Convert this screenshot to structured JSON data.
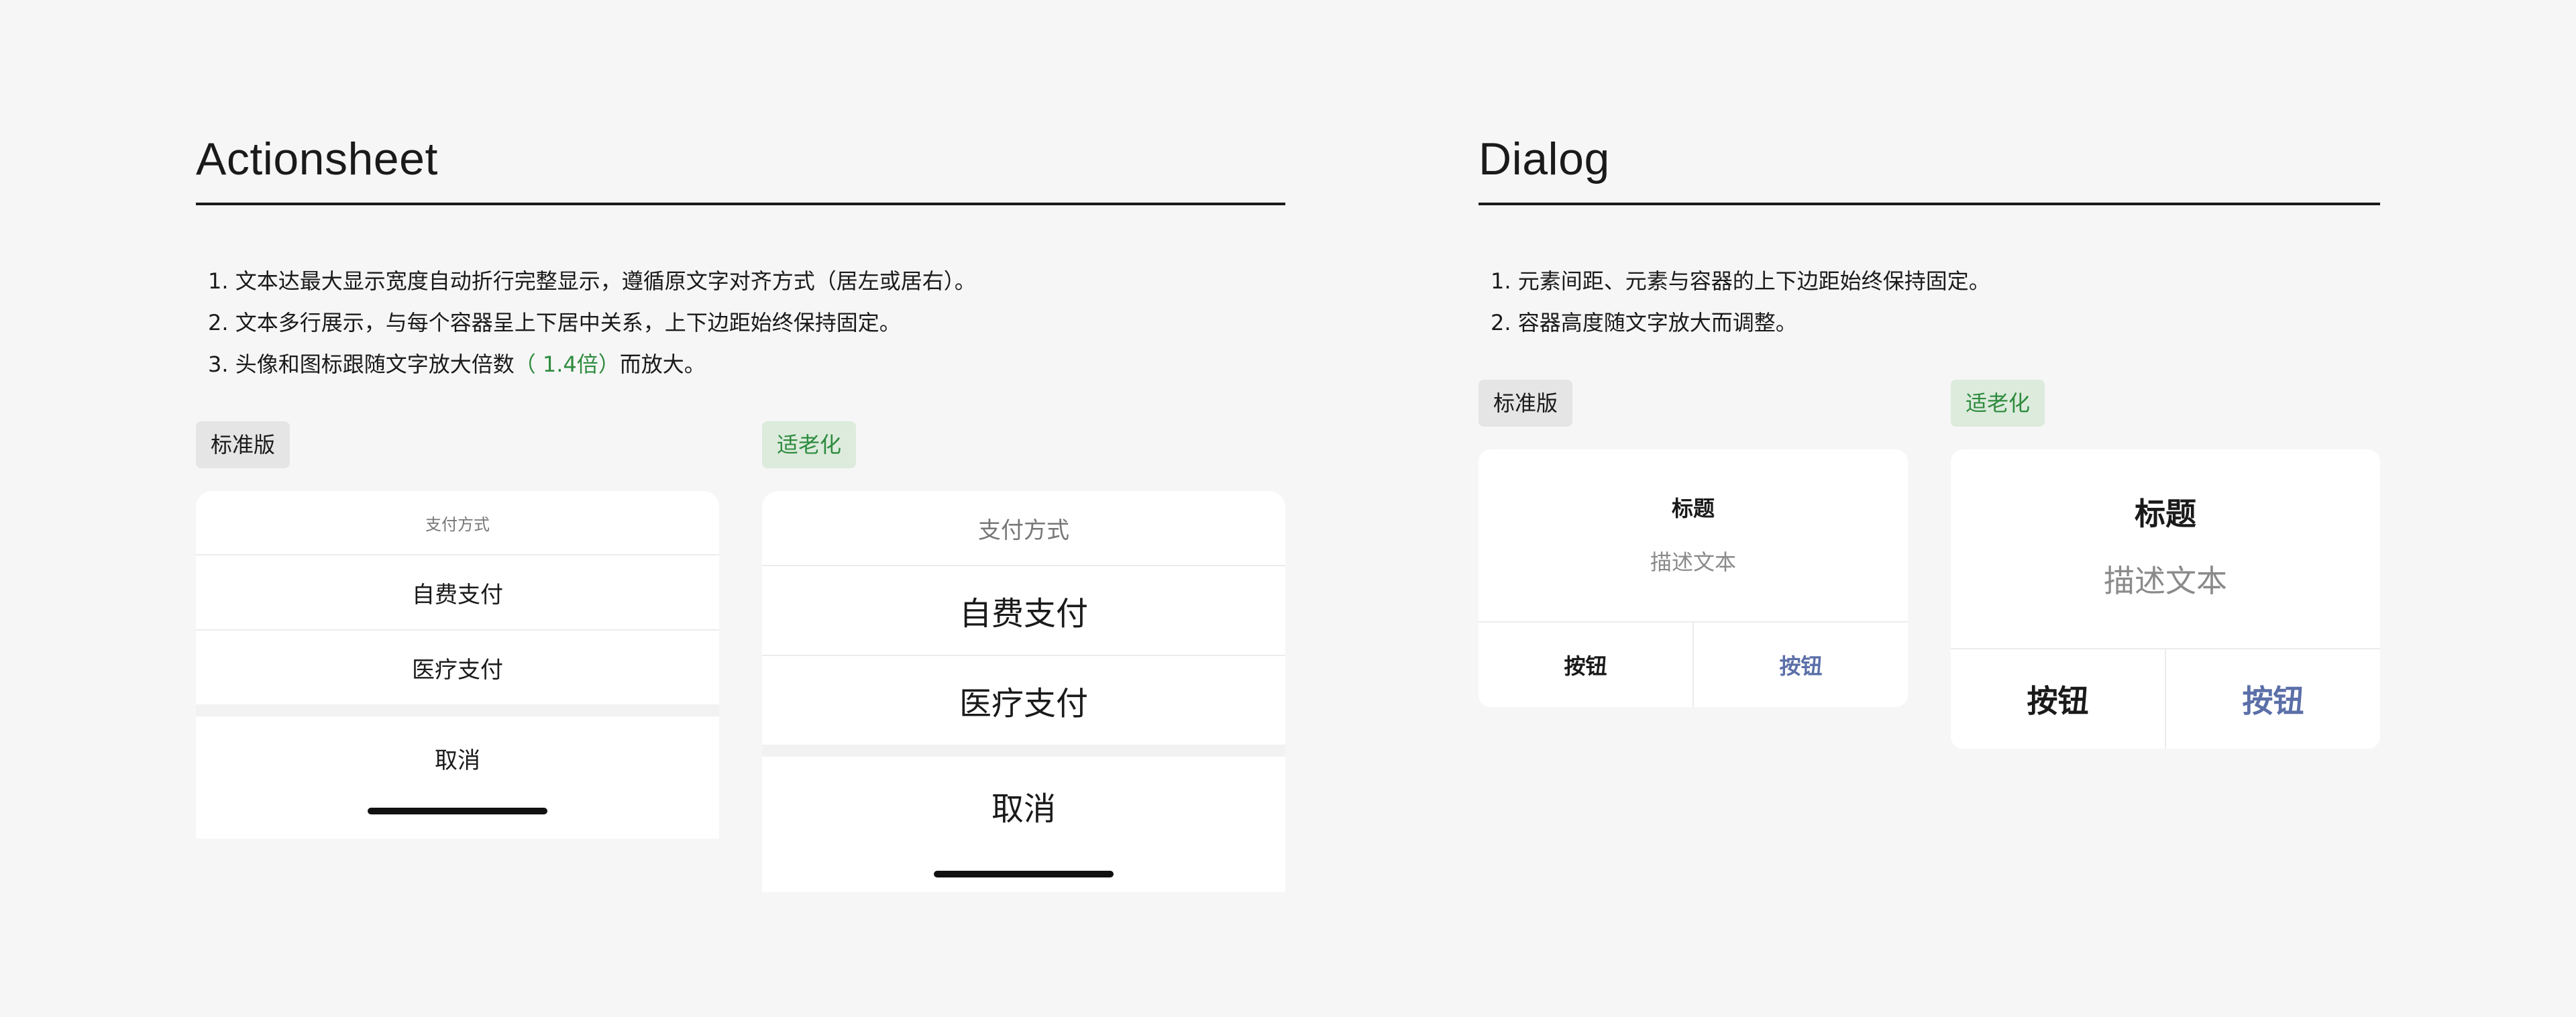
{
  "colors": {
    "background": "#f6f6f6",
    "accent_green": "#2e8b3e",
    "link_blue": "#5b6fa8",
    "text": "#1a1a1a"
  },
  "actionsheet": {
    "title": "Actionsheet",
    "rules": [
      {
        "prefix": "1. 文本达最大显示宽度自动折行完整显示，遵循原文字对齐方式（居左或居右）。",
        "highlight": "",
        "suffix": ""
      },
      {
        "prefix": "2. 文本多行展示，与每个容器呈上下居中关系，上下边距始终保持固定。",
        "highlight": "",
        "suffix": ""
      },
      {
        "prefix": "3. 头像和图标跟随文字放大倍数",
        "highlight": "（ 1.4倍）",
        "suffix": "而放大。"
      }
    ],
    "standard": {
      "tag": "标准版",
      "header": "支付方式",
      "options": [
        "自费支付",
        "医疗支付"
      ],
      "cancel": "取消"
    },
    "elderly": {
      "tag": "适老化",
      "header": "支付方式",
      "options": [
        "自费支付",
        "医疗支付"
      ],
      "cancel": "取消"
    }
  },
  "dialog": {
    "title": "Dialog",
    "rules": [
      "1. 元素间距、元素与容器的上下边距始终保持固定。",
      "2. 容器高度随文字放大而调整。"
    ],
    "standard": {
      "tag": "标准版",
      "heading": "标题",
      "description": "描述文本",
      "secondary_button": "按钮",
      "primary_button": "按钮"
    },
    "elderly": {
      "tag": "适老化",
      "heading": "标题",
      "description": "描述文本",
      "secondary_button": "按钮",
      "primary_button": "按钮"
    }
  }
}
